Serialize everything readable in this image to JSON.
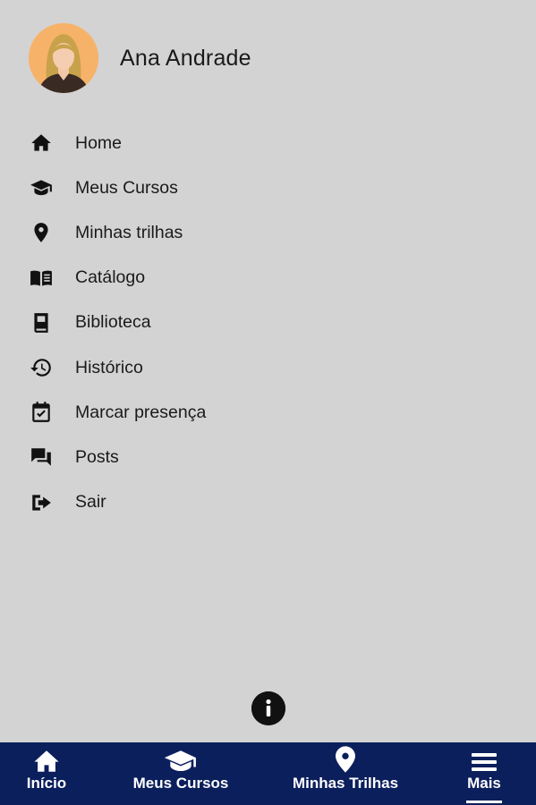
{
  "profile": {
    "name": "Ana Andrade"
  },
  "menu": {
    "items": [
      {
        "label": "Home",
        "icon": "home-icon"
      },
      {
        "label": "Meus Cursos",
        "icon": "graduation-cap-icon"
      },
      {
        "label": "Minhas trilhas",
        "icon": "map-pin-icon"
      },
      {
        "label": "Catálogo",
        "icon": "open-book-icon"
      },
      {
        "label": "Biblioteca",
        "icon": "book-icon"
      },
      {
        "label": "Histórico",
        "icon": "history-icon"
      },
      {
        "label": "Marcar presença",
        "icon": "calendar-check-icon"
      },
      {
        "label": "Posts",
        "icon": "chat-bubbles-icon"
      },
      {
        "label": "Sair",
        "icon": "sign-out-icon"
      }
    ]
  },
  "info": {
    "icon": "info-icon"
  },
  "bottom_nav": {
    "items": [
      {
        "label": "Início",
        "icon": "home-icon"
      },
      {
        "label": "Meus Cursos",
        "icon": "graduation-cap-icon"
      },
      {
        "label": "Minhas Trilhas",
        "icon": "map-pin-icon"
      },
      {
        "label": "Mais",
        "icon": "menu-icon",
        "active": true
      }
    ]
  },
  "colors": {
    "background": "#d3d3d3",
    "nav_background": "#0b1f5c",
    "avatar_background": "#f7b26a"
  }
}
